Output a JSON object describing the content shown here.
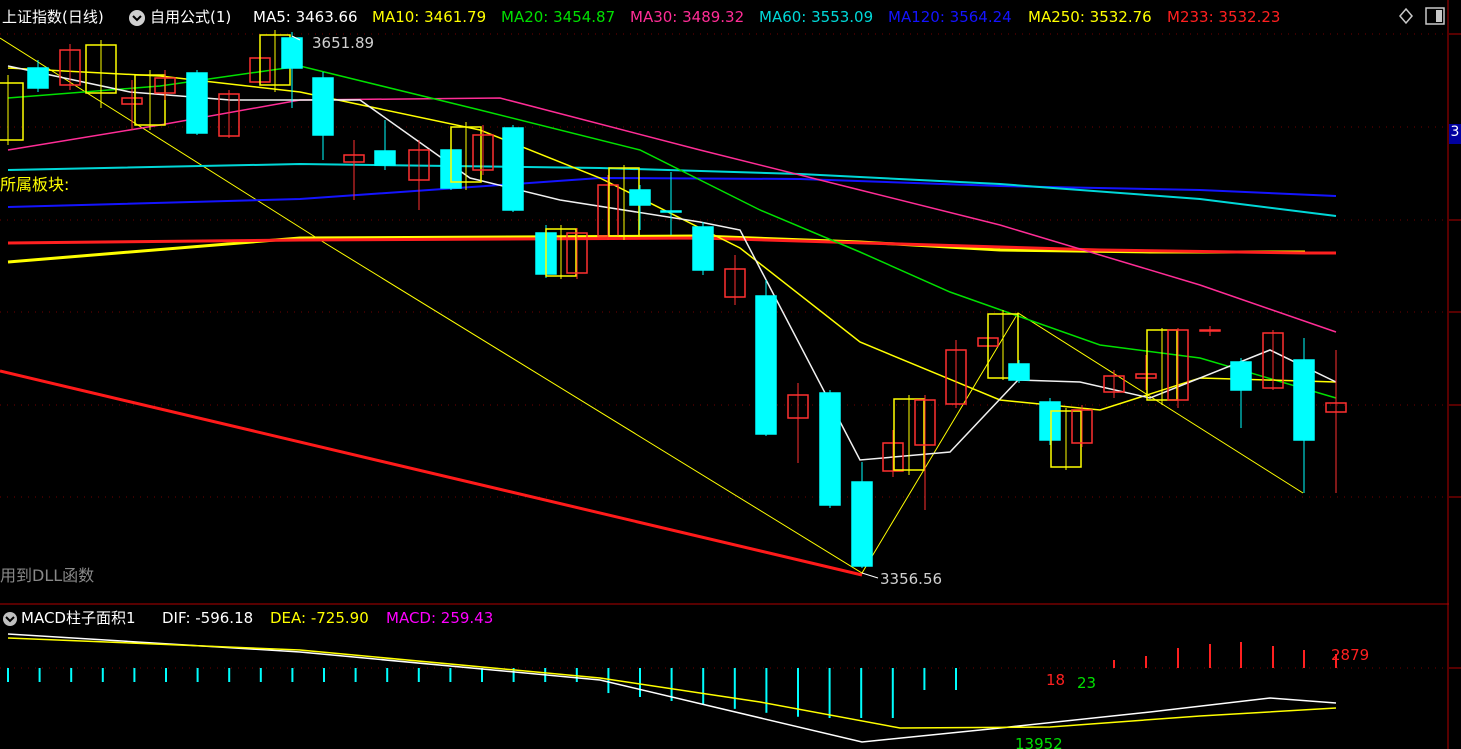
{
  "header": {
    "index_title": "上证指数(日线)",
    "formula_label": "自用公式(1)",
    "ma": [
      {
        "label": "MA5: 3463.66",
        "color": "#ffffff"
      },
      {
        "label": "MA10: 3461.79",
        "color": "#ffff00"
      },
      {
        "label": "MA20: 3454.87",
        "color": "#00e000"
      },
      {
        "label": "MA30: 3489.32",
        "color": "#ff2d96"
      },
      {
        "label": "MA60: 3553.09",
        "color": "#00d8d8"
      },
      {
        "label": "MA120: 3564.24",
        "color": "#1414ff"
      },
      {
        "label": "MA250: 3532.76",
        "color": "#ffff00"
      },
      {
        "label": "M233: 3532.23",
        "color": "#ff2020"
      }
    ]
  },
  "main_chart": {
    "high_label": "3651.89",
    "low_label": "3356.56",
    "sector_label": "所属板块:",
    "dll_label": "用到DLL函数",
    "right_edge_label": "3",
    "candle_colors": {
      "up": "#ff3030",
      "down": "#00ffff",
      "marker": "#ffff00"
    }
  },
  "macd": {
    "title": "MACD柱子面积1",
    "dif": "DIF: -596.18",
    "dea": "DEA: -725.90",
    "macd": "MACD: 259.43",
    "colors": {
      "dif": "#ffffff",
      "dea": "#ffff00",
      "macd": "#ff00ff"
    },
    "area_labels": [
      {
        "text": "18",
        "color": "#ff2020"
      },
      {
        "text": "23",
        "color": "#00e000"
      },
      {
        "text": "2879",
        "color": "#ff2020"
      },
      {
        "text": "13952",
        "color": "#00e000"
      }
    ]
  }
}
